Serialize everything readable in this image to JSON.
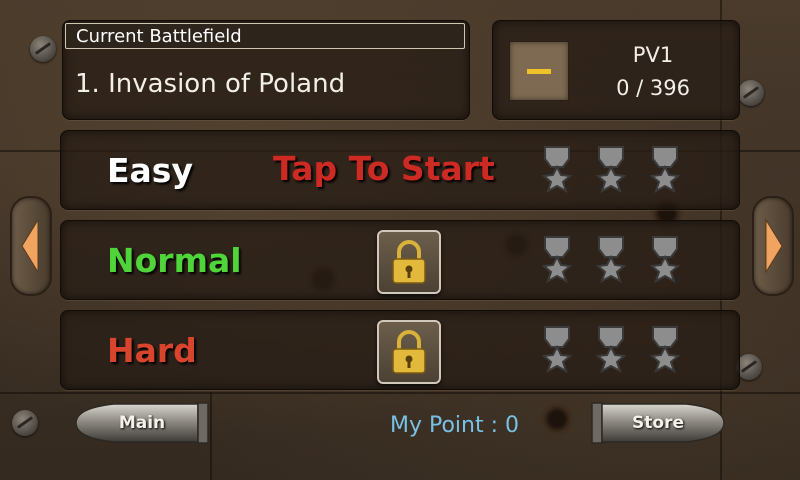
{
  "header": {
    "battlefield_label": "Current Battlefield",
    "battlefield_name": "1. Invasion of Poland"
  },
  "pv": {
    "label": "PV1",
    "value": "0 / 396"
  },
  "difficulties": [
    {
      "label": "Easy",
      "color": "#ffffff",
      "status": "Tap To Start",
      "locked": false,
      "medals_earned": 0,
      "medals_total": 3
    },
    {
      "label": "Normal",
      "color": "#4fd53a",
      "status": "",
      "locked": true,
      "medals_earned": 0,
      "medals_total": 3
    },
    {
      "label": "Hard",
      "color": "#d9452c",
      "status": "",
      "locked": true,
      "medals_earned": 0,
      "medals_total": 3
    }
  ],
  "footer": {
    "main_label": "Main",
    "store_label": "Store",
    "point_label": "My Point : 0"
  },
  "icons": {
    "nav_left": "arrow-left-icon",
    "nav_right": "arrow-right-icon",
    "lock": "padlock-icon",
    "medal": "medal-icon"
  },
  "colors": {
    "status_red": "#cc2a22",
    "point_blue": "#78c1e6",
    "badge_gold": "#f0c22a"
  }
}
